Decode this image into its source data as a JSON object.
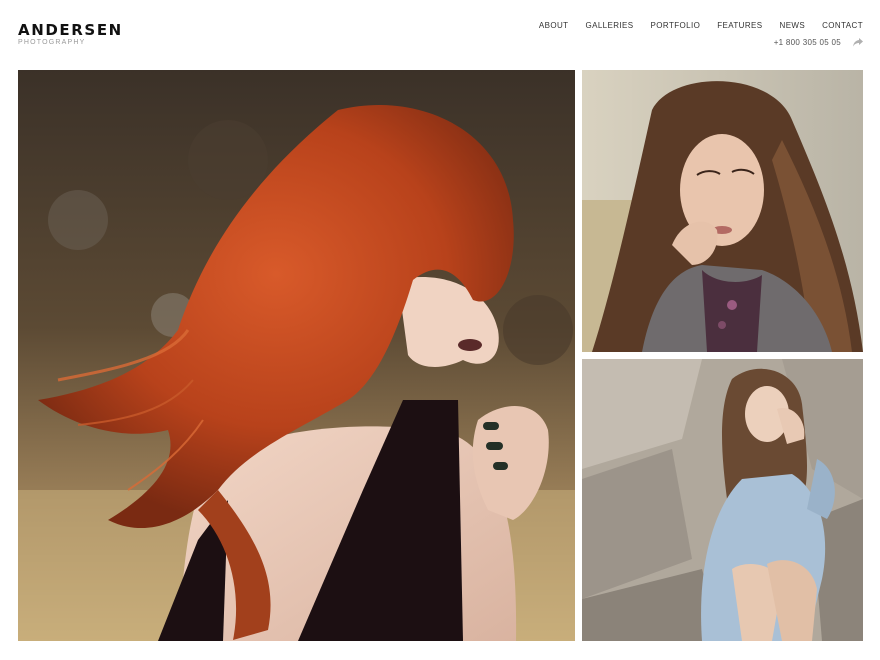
{
  "brand": {
    "name": "ANDERSEN",
    "tagline": "PHOTOGRAPHY"
  },
  "nav": {
    "items": [
      {
        "label": "ABOUT"
      },
      {
        "label": "GALLERIES"
      },
      {
        "label": "PORTFOLIO"
      },
      {
        "label": "FEATURES"
      },
      {
        "label": "NEWS"
      },
      {
        "label": "CONTACT"
      }
    ]
  },
  "contact": {
    "phone": "+1 800 305 05 05",
    "share_icon": "share-icon"
  },
  "colors": {
    "logo": "#111111",
    "nav_text": "#333333",
    "muted": "#9a9a9a",
    "hair": "#c1431c"
  },
  "gallery": {
    "images": [
      {
        "name": "redhead-portrait"
      },
      {
        "name": "brunette-portrait"
      },
      {
        "name": "woman-on-rocks"
      }
    ]
  }
}
